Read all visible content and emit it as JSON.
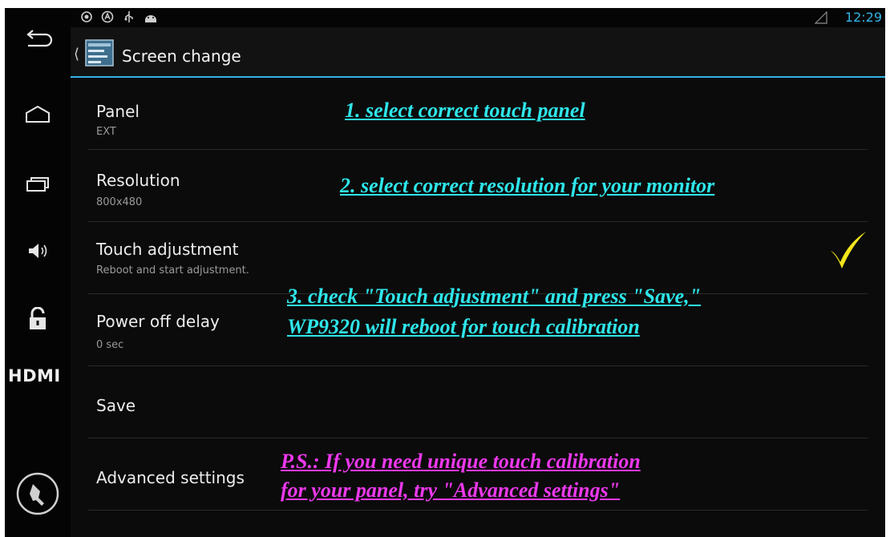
{
  "status": {
    "time": "12:29",
    "icons": [
      "location-icon",
      "android-debug-icon",
      "usb-icon",
      "android-icon"
    ]
  },
  "actionbar": {
    "title": "Screen change"
  },
  "nav": {
    "hdmi_label": "HDMI",
    "buttons": [
      "back-icon",
      "home-icon",
      "recent-apps-icon",
      "volume-icon",
      "unlock-icon",
      "settings-wrench-icon"
    ]
  },
  "settings": {
    "panel": {
      "title": "Panel",
      "summary": "EXT"
    },
    "resolution": {
      "title": "Resolution",
      "summary": "800x480"
    },
    "touch_adjustment": {
      "title": "Touch adjustment",
      "summary": "Reboot and start adjustment.",
      "checked": true
    },
    "power_off_delay": {
      "title": "Power off delay",
      "summary": "0 sec"
    },
    "save": {
      "title": "Save"
    },
    "advanced": {
      "title": "Advanced settings"
    }
  },
  "annotations": {
    "step1": "1. select correct touch panel",
    "step2": "2. select correct resolution for your monitor",
    "step3_line1": "3. check \"Touch adjustment\" and press \"Save,\"",
    "step3_line2": "WP9320 will reboot for touch calibration",
    "ps_line1": "P.S.: If you need unique touch calibration",
    "ps_line2": "for your panel, try \"Advanced settings\""
  },
  "colors": {
    "accent": "#33b5e5",
    "annotation_cyan": "#2ee6ea",
    "annotation_pink": "#ee38ee",
    "checkmark": "#f2e51a"
  }
}
